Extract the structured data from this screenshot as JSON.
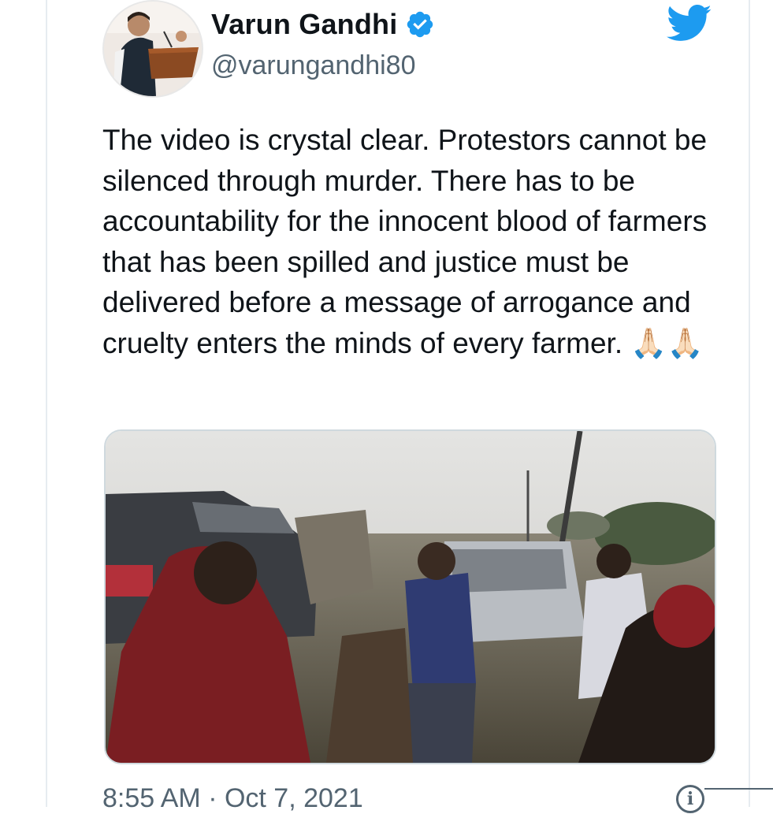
{
  "tweet": {
    "author_name": "Varun Gandhi",
    "handle": "@varungandhi80",
    "text": "The video is crystal clear. Protestors cannot be silenced through murder. There has to be accountability for the innocent blood of farmers that has been spilled and justice must be delivered before a message of arrogance and cruelty enters the minds of every farmer. 🙏🏻🙏🏻",
    "timestamp": "8:55 AM · Oct 7, 2021",
    "info_glyph": "i"
  },
  "icons": {
    "verified": "verified-badge-icon",
    "brand": "twitter-bird-icon",
    "info": "info-icon"
  },
  "colors": {
    "brand_blue": "#1d9bf0",
    "text_primary": "#0f1419",
    "text_secondary": "#536471"
  }
}
